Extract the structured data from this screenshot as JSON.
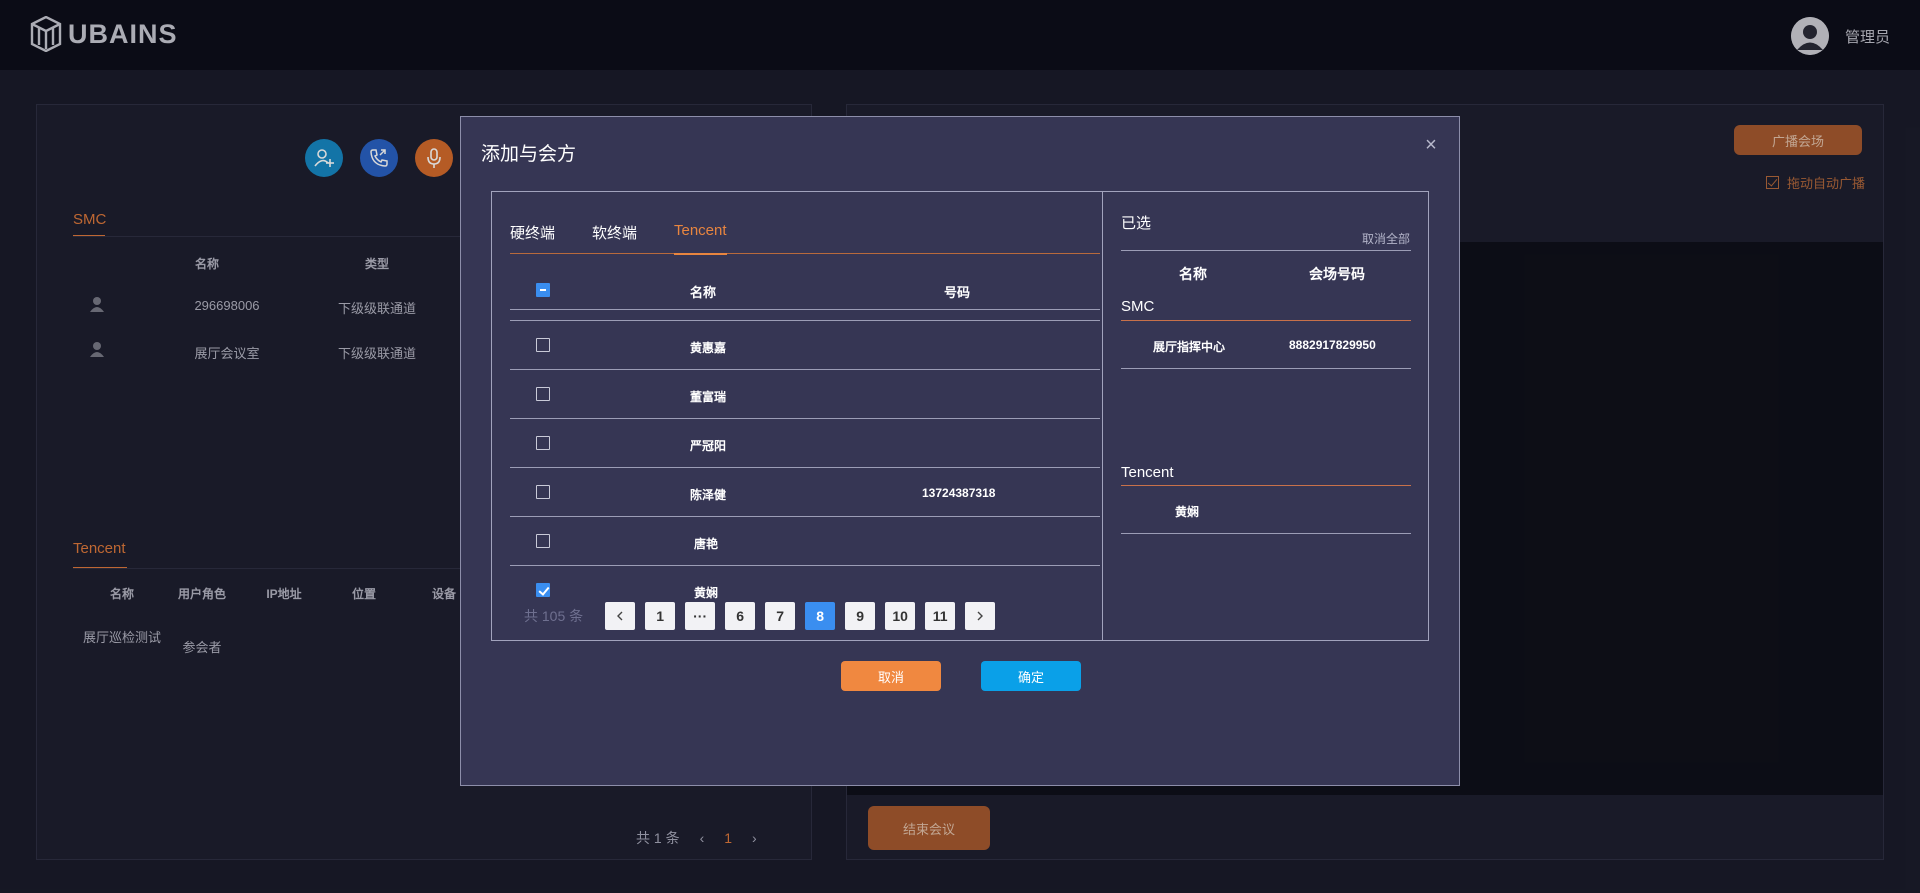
{
  "app": {
    "logo_text": "UBAINS",
    "user_name": "管理员"
  },
  "left_panel": {
    "smc": {
      "title": "SMC",
      "headers": [
        "名称",
        "类型"
      ],
      "rows": [
        {
          "name": "296698006",
          "type": "下级级联通道"
        },
        {
          "name": "展厅会议室",
          "type": "下级级联通道"
        }
      ]
    },
    "tencent": {
      "title": "Tencent",
      "headers": [
        "名称",
        "用户角色",
        "IP地址",
        "位置",
        "设备"
      ],
      "rows": [
        {
          "name": "展厅巡检测试",
          "role": "参会者"
        }
      ]
    },
    "pager": {
      "total": "共 1 条",
      "current": "1"
    }
  },
  "right_panel": {
    "broadcast_button": "广播会场",
    "auto_broadcast_label": "拖动自动广播",
    "end_button": "结束会议"
  },
  "modal": {
    "title": "添加与会方",
    "tabs": [
      {
        "label": "硬终端",
        "active": false
      },
      {
        "label": "软终端",
        "active": false
      },
      {
        "label": "Tencent",
        "active": true
      }
    ],
    "table_headers": {
      "name": "名称",
      "number": "号码"
    },
    "rows": [
      {
        "name": "黄惠嘉",
        "number": "",
        "checked": false
      },
      {
        "name": "董富瑞",
        "number": "",
        "checked": false
      },
      {
        "name": "严冠阳",
        "number": "",
        "checked": false
      },
      {
        "name": "陈泽健",
        "number": "13724387318",
        "checked": false
      },
      {
        "name": "唐艳",
        "number": "",
        "checked": false
      },
      {
        "name": "黄娴",
        "number": "",
        "checked": true
      }
    ],
    "pagination": {
      "total": "共 105 条",
      "pages": [
        "1",
        "···",
        "6",
        "7",
        "8",
        "9",
        "10",
        "11"
      ],
      "current": "8"
    },
    "selected": {
      "title": "已选",
      "clear_all": "取消全部",
      "headers": {
        "name": "名称",
        "number": "会场号码"
      },
      "groups": [
        {
          "title": "SMC",
          "items": [
            {
              "name": "展厅指挥中心",
              "number": "8882917829950"
            }
          ]
        },
        {
          "title": "Tencent",
          "items": [
            {
              "name": "黄娴",
              "number": ""
            }
          ]
        }
      ]
    },
    "cancel_label": "取消",
    "ok_label": "确定"
  },
  "colors": {
    "accent": "#e8853f",
    "primary": "#0aa0e8",
    "checkbox": "#3a8ef0",
    "modal_bg": "#363654"
  }
}
